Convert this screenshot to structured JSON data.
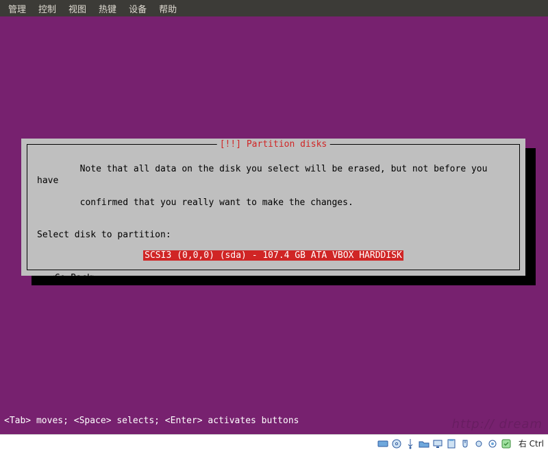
{
  "menubar": {
    "items": [
      "管理",
      "控制",
      "视图",
      "热键",
      "设备",
      "帮助"
    ]
  },
  "dialog": {
    "title": "[!!] Partition disks",
    "note_line1": "Note that all data on the disk you select will be erased, but not before you have",
    "note_line2": "confirmed that you really want to make the changes.",
    "select_label": "Select disk to partition:",
    "selected_disk": "SCSI3 (0,0,0) (sda) - 107.4 GB ATA VBOX HARDDISK",
    "go_back": "<Go Back>"
  },
  "hint": "<Tab> moves; <Space> selects; <Enter> activates buttons",
  "statusbar": {
    "hostkey_label": "右 Ctrl"
  },
  "icons": [
    "disk-icon",
    "cd-icon",
    "usb-icon",
    "folder-icon",
    "display-icon",
    "clipboard-icon",
    "mouse-icon",
    "record-icon",
    "settings-icon",
    "power-icon"
  ]
}
